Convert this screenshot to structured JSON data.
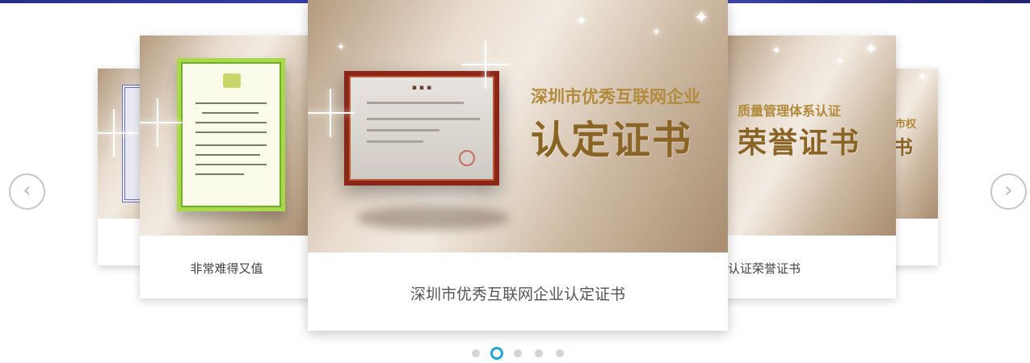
{
  "carousel": {
    "slides": [
      {
        "id": "far-left",
        "caption": ""
      },
      {
        "id": "left",
        "caption": "非常难得又值"
      },
      {
        "id": "center",
        "caption": "深圳市优秀互联网企业认定证书",
        "image_title_small": "深圳市优秀互联网企业",
        "image_title_big": "认定证书"
      },
      {
        "id": "right",
        "caption": "认证荣誉证书",
        "image_title_small": "质量管理体系认证",
        "image_title_big": "荣誉证书"
      },
      {
        "id": "far-right",
        "caption": "",
        "image_title_small": "市权",
        "image_title_big": "书"
      }
    ],
    "active_index": 1,
    "dot_count": 5,
    "prev_icon": "chevron-left-icon",
    "next_icon": "chevron-right-icon",
    "prev_glyph": "‹",
    "next_glyph": "›"
  },
  "colors": {
    "accent": "#1fa6d4",
    "dot_inactive": "#d4d4d4",
    "title_gold": "#8a6425",
    "top_bar": "#3b3fa8"
  }
}
